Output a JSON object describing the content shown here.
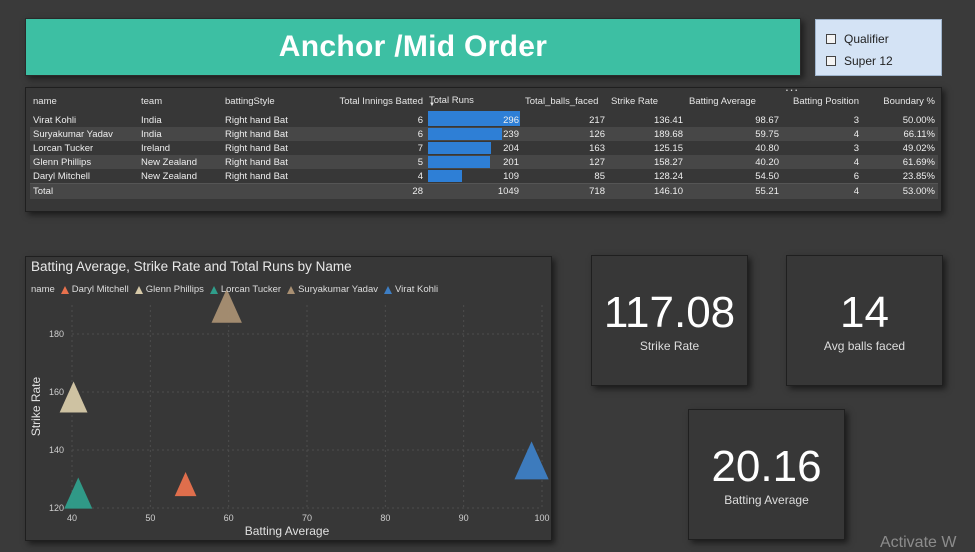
{
  "header": {
    "title": "Anchor /Mid Order"
  },
  "slicer": {
    "items": [
      "Qualifier",
      "Super 12"
    ]
  },
  "table": {
    "more_label": "...",
    "columns": [
      "name",
      "team",
      "battingStyle",
      "Total Innings Batted",
      "Total Runs",
      "Total_balls_faced",
      "Strike Rate",
      "Batting Average",
      "Batting Position",
      "Boundary %"
    ],
    "rows": [
      [
        "Virat Kohli",
        "India",
        "Right hand Bat",
        "6",
        "296",
        "217",
        "136.41",
        "98.67",
        "3",
        "50.00%"
      ],
      [
        "Suryakumar Yadav",
        "India",
        "Right hand Bat",
        "6",
        "239",
        "126",
        "189.68",
        "59.75",
        "4",
        "66.11%"
      ],
      [
        "Lorcan Tucker",
        "Ireland",
        "Right hand Bat",
        "7",
        "204",
        "163",
        "125.15",
        "40.80",
        "3",
        "49.02%"
      ],
      [
        "Glenn Phillips",
        "New Zealand",
        "Right hand Bat",
        "5",
        "201",
        "127",
        "158.27",
        "40.20",
        "4",
        "61.69%"
      ],
      [
        "Daryl Mitchell",
        "New Zealand",
        "Right hand Bat",
        "4",
        "109",
        "85",
        "128.24",
        "54.50",
        "6",
        "23.85%"
      ]
    ],
    "total": [
      "Total",
      "",
      "",
      "28",
      "1049",
      "718",
      "146.10",
      "55.21",
      "4",
      "53.00%"
    ],
    "bar_max": 296
  },
  "chart_data": {
    "type": "scatter",
    "title": "Batting Average, Strike Rate and Total Runs by Name",
    "xlabel": "Batting Average",
    "ylabel": "Strike Rate",
    "legend_title": "name",
    "legend_position": "top-left",
    "xlim": [
      40,
      100
    ],
    "ylim": [
      120,
      190
    ],
    "xticks": [
      40,
      50,
      60,
      70,
      80,
      90,
      100
    ],
    "yticks": [
      120,
      140,
      160,
      180
    ],
    "grid": true,
    "series": [
      {
        "name": "Daryl Mitchell",
        "x": 54.5,
        "y": 128.24,
        "size": 109,
        "color": "#e8714d"
      },
      {
        "name": "Glenn Phillips",
        "x": 40.2,
        "y": 158.27,
        "size": 201,
        "color": "#d6c9a8"
      },
      {
        "name": "Lorcan Tucker",
        "x": 40.8,
        "y": 125.15,
        "size": 204,
        "color": "#2f9e8b"
      },
      {
        "name": "Suryakumar Yadav",
        "x": 59.75,
        "y": 189.68,
        "size": 239,
        "color": "#a88f72"
      },
      {
        "name": "Virat Kohli",
        "x": 98.67,
        "y": 136.41,
        "size": 296,
        "color": "#3d7ec4"
      }
    ]
  },
  "cards": {
    "strike_rate": {
      "value": "117.08",
      "label": "Strike Rate"
    },
    "balls": {
      "value": "14",
      "label": "Avg balls faced"
    },
    "avg": {
      "value": "20.16",
      "label": "Batting Average"
    }
  },
  "watermark": "Activate W"
}
